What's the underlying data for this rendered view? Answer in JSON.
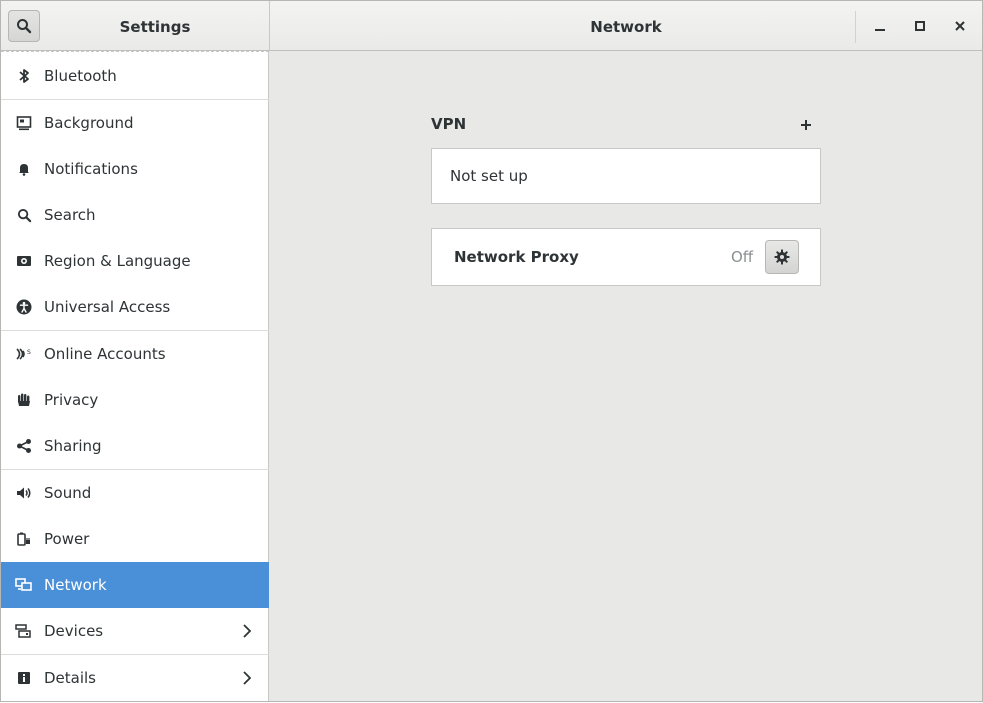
{
  "header": {
    "sidebar_title": "Settings",
    "main_title": "Network",
    "icons": {
      "search": "search-icon",
      "minimize": "minimize-icon",
      "maximize": "maximize-icon",
      "close": "close-icon"
    }
  },
  "sidebar": {
    "items": [
      {
        "label": "Bluetooth",
        "icon": "bluetooth-icon"
      },
      {
        "label": "Background",
        "icon": "background-icon"
      },
      {
        "label": "Notifications",
        "icon": "bell-icon"
      },
      {
        "label": "Search",
        "icon": "search-icon"
      },
      {
        "label": "Region & Language",
        "icon": "flag-icon"
      },
      {
        "label": "Universal Access",
        "icon": "accessibility-icon"
      },
      {
        "label": "Online Accounts",
        "icon": "online-accounts-icon"
      },
      {
        "label": "Privacy",
        "icon": "hand-icon"
      },
      {
        "label": "Sharing",
        "icon": "share-icon"
      },
      {
        "label": "Sound",
        "icon": "speaker-icon"
      },
      {
        "label": "Power",
        "icon": "power-icon"
      },
      {
        "label": "Network",
        "icon": "network-icon",
        "selected": true
      },
      {
        "label": "Devices",
        "icon": "devices-icon",
        "has_submenu": true
      },
      {
        "label": "Details",
        "icon": "info-icon",
        "has_submenu": true
      }
    ]
  },
  "vpn": {
    "heading": "VPN",
    "empty_text": "Not set up"
  },
  "proxy": {
    "label": "Network Proxy",
    "status": "Off"
  },
  "colors": {
    "accent": "#4a90d9",
    "background": "#e8e8e7",
    "text": "#2e3436",
    "muted_text": "#8a8f8f"
  }
}
